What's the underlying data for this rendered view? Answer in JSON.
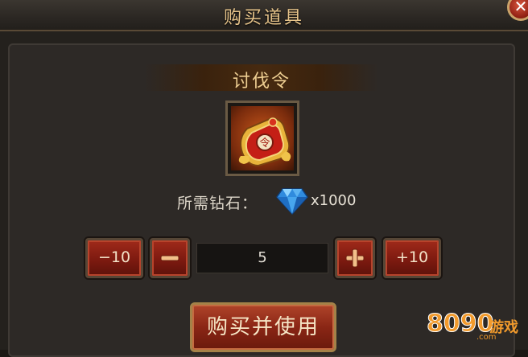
{
  "dialog": {
    "title": "购买道具",
    "close_icon": "close-icon"
  },
  "item": {
    "name": "讨伐令",
    "icon": "order-token-icon"
  },
  "price": {
    "label": "所需钻石：",
    "currency_icon": "diamond-icon",
    "value": "x1000"
  },
  "quantity": {
    "minus10_label": "−10",
    "minus_icon": "minus-icon",
    "value": "5",
    "plus_icon": "plus-icon",
    "plus10_label": "+10"
  },
  "actions": {
    "buy_use_label": "购买并使用"
  },
  "watermark": {
    "number": "8090",
    "text": "游戏",
    "domain": ".com"
  }
}
